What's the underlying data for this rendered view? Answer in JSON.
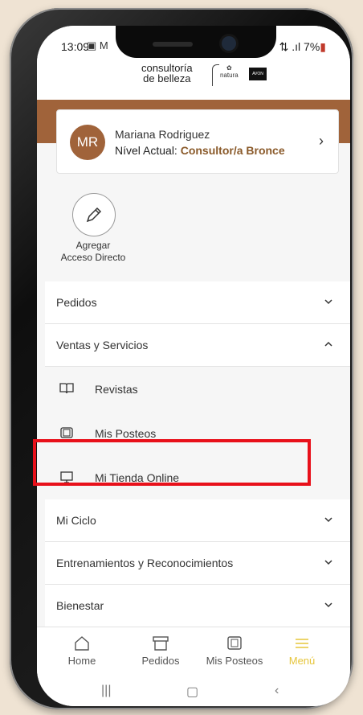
{
  "status": {
    "time": "13:09",
    "left_icons": "▣ M",
    "battery": "7%"
  },
  "brand": {
    "line1": "consultoría",
    "line2": "de belleza",
    "natura": "natura",
    "avon": "AVON"
  },
  "profile": {
    "initials": "MR",
    "name": "Mariana Rodriguez",
    "level_prefix": "Nível Actual:",
    "level": "Consultor/a Bronce"
  },
  "shortcut": {
    "line1": "Agregar",
    "line2": "Acceso Directo"
  },
  "menu": {
    "pedidos": "Pedidos",
    "ventas": "Ventas y Servicios",
    "sub": {
      "revistas": "Revistas",
      "posteos": "Mis Posteos",
      "tienda": "Mi Tienda Online"
    },
    "ciclo": "Mi Ciclo",
    "entrenamientos": "Entrenamientos y Reconocimientos",
    "bienestar": "Bienestar"
  },
  "tabs": [
    {
      "label": "Home",
      "icon": "home-icon"
    },
    {
      "label": "Pedidos",
      "icon": "box-icon"
    },
    {
      "label": "Mis Posteos",
      "icon": "posts-icon"
    },
    {
      "label": "Menú",
      "icon": "menu-icon"
    }
  ],
  "colors": {
    "brand_brown": "#a0633a",
    "highlight_red": "#e8101a",
    "active_tab": "#e6c53a"
  }
}
